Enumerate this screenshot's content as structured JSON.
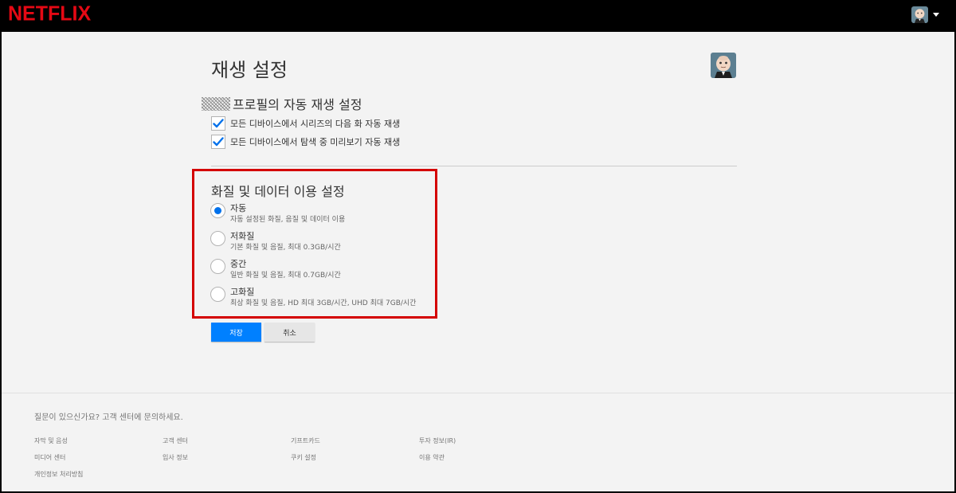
{
  "header": {
    "logo": "NETFLIX",
    "avatar_icon": "profile-avatar-icon"
  },
  "page": {
    "title": "재생 설정"
  },
  "autoplay": {
    "section_title": "프로필의 자동 재생 설정",
    "options": [
      {
        "label": "모든 디바이스에서 시리즈의 다음 화 자동 재생",
        "checked": true
      },
      {
        "label": "모든 디바이스에서 탐색 중 미리보기 자동 재생",
        "checked": true
      }
    ]
  },
  "quality": {
    "section_title": "화질 및 데이터 이용 설정",
    "options": [
      {
        "label": "자동",
        "desc": "자동 설정된 화질, 음질 및 데이터 이용",
        "selected": true
      },
      {
        "label": "저화질",
        "desc": "기본 화질 및 음질, 최대 0.3GB/시간",
        "selected": false
      },
      {
        "label": "중간",
        "desc": "일반 화질 및 음질, 최대 0.7GB/시간",
        "selected": false
      },
      {
        "label": "고화질",
        "desc": "최상 화질 및 음질, HD 최대 3GB/시간, UHD 최대 7GB/시간",
        "selected": false
      }
    ]
  },
  "buttons": {
    "save": "저장",
    "cancel": "취소"
  },
  "footer": {
    "question": "질문이 있으신가요? 고객 센터에 문의하세요.",
    "links": [
      "자막 및 음성",
      "고객 센터",
      "기프트카드",
      "투자 정보(IR)",
      "미디어 센터",
      "입사 정보",
      "쿠키 설정",
      "이용 약관",
      "개인정보 처리방침"
    ]
  },
  "colors": {
    "brand_red": "#e50914",
    "accent_blue": "#0080ff",
    "highlight_red": "#d40000"
  }
}
